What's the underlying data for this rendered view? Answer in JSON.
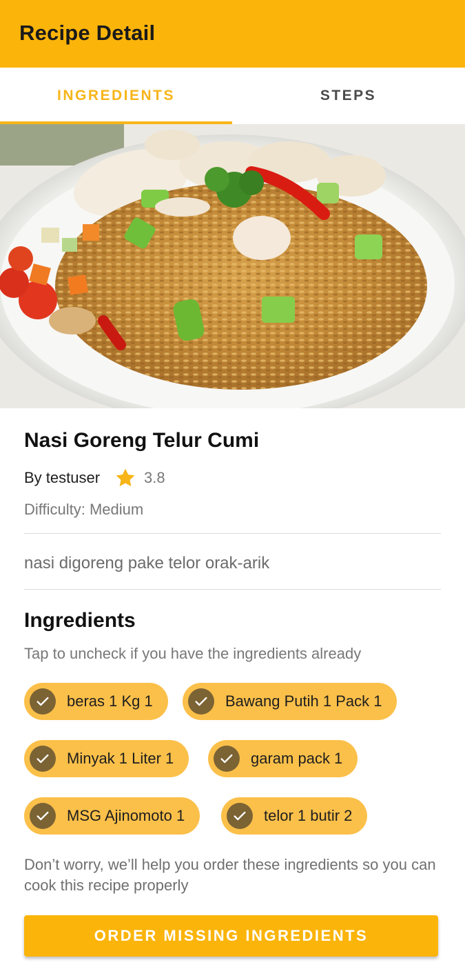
{
  "app_bar": {
    "title": "Recipe Detail"
  },
  "tabs": [
    {
      "label": "INGREDIENTS",
      "selected": true
    },
    {
      "label": "STEPS",
      "selected": false
    }
  ],
  "recipe": {
    "name": "Nasi Goreng Telur Cumi",
    "author": "By testuser",
    "rating": "3.8",
    "difficulty": "Difficulty: Medium",
    "description": "nasi digoreng pake telor orak-arik"
  },
  "ingredients_section": {
    "heading": "Ingredients",
    "hint": "Tap to uncheck if you have the ingredients already",
    "items": [
      {
        "label": "beras 1 Kg 1",
        "checked": true,
        "icon": "check-icon"
      },
      {
        "label": "Bawang Putih 1 Pack 1",
        "checked": true,
        "icon": "check-icon"
      },
      {
        "label": "Minyak 1 Liter 1",
        "checked": true,
        "icon": "check-icon"
      },
      {
        "label": "garam pack 1",
        "checked": true,
        "icon": "check-icon"
      },
      {
        "label": "MSG Ajinomoto 1",
        "checked": true,
        "icon": "check-icon"
      },
      {
        "label": "telor 1 butir 2",
        "checked": true,
        "icon": "check-icon"
      }
    ],
    "note": "Don’t worry, we’ll help you order these ingredients so you can cook this recipe properly",
    "order_button": "ORDER MISSING INGREDIENTS"
  },
  "colors": {
    "primary": "#FBB40A",
    "chip": "#FBC04A",
    "chip_check": "#7B6334",
    "tab_selected": "#F7B519"
  }
}
